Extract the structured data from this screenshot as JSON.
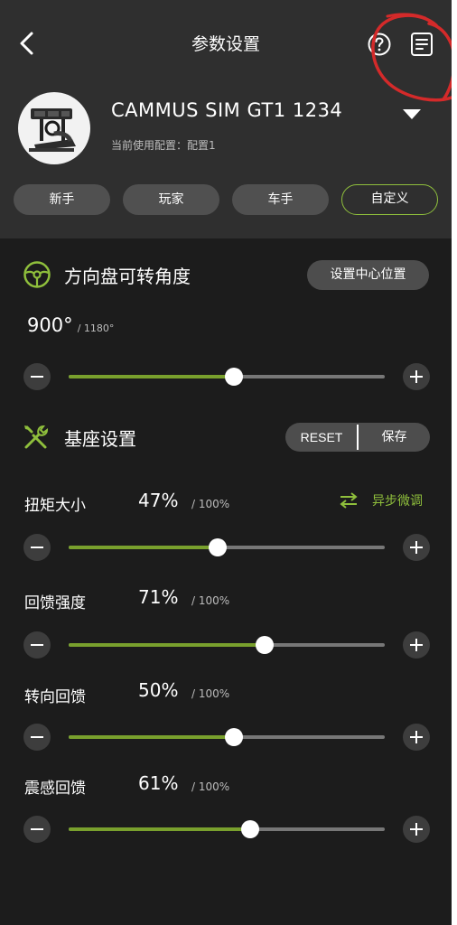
{
  "header": {
    "title": "参数设置",
    "back_icon": "chevron-left-icon",
    "help_icon": "question-circle-icon",
    "doc_icon": "document-list-icon",
    "background": "#2f2f2f"
  },
  "device": {
    "name": "CAMMUS SIM GT1 1234",
    "config_label": "当前使用配置：配置1",
    "avatar_icon": "racing-rig-image",
    "dropdown_icon": "caret-down-icon"
  },
  "presets": [
    {
      "label": "新手",
      "active": false
    },
    {
      "label": "玩家",
      "active": false
    },
    {
      "label": "车手",
      "active": false
    },
    {
      "label": "自定义",
      "active": true
    }
  ],
  "steering": {
    "title": "方向盘可转角度",
    "icon": "steering-wheel-icon",
    "center_button": "设置中心位置",
    "value": "900°",
    "max": "/ 1180°",
    "fraction": 0.524
  },
  "base": {
    "title": "基座设置",
    "icon": "tools-icon",
    "reset_label": "RESET",
    "save_label": "保存"
  },
  "sync": {
    "label": "异步微调",
    "icon": "swap-arrows-icon"
  },
  "params": [
    {
      "label": "扭矩大小",
      "value": "47%",
      "max": "/ 100%",
      "fraction": 0.47
    },
    {
      "label": "回馈强度",
      "value": "71%",
      "max": "/ 100%",
      "fraction": 0.62
    },
    {
      "label": "转向回馈",
      "value": "50%",
      "max": "/ 100%",
      "fraction": 0.524
    },
    {
      "label": "震感回馈",
      "value": "61%",
      "max": "/ 100%",
      "fraction": 0.574
    }
  ],
  "colors": {
    "accent": "#79a02d",
    "accent_text": "#8fbf3c",
    "background": "#1c1c1c",
    "annotation_red": "#d42a2a"
  }
}
